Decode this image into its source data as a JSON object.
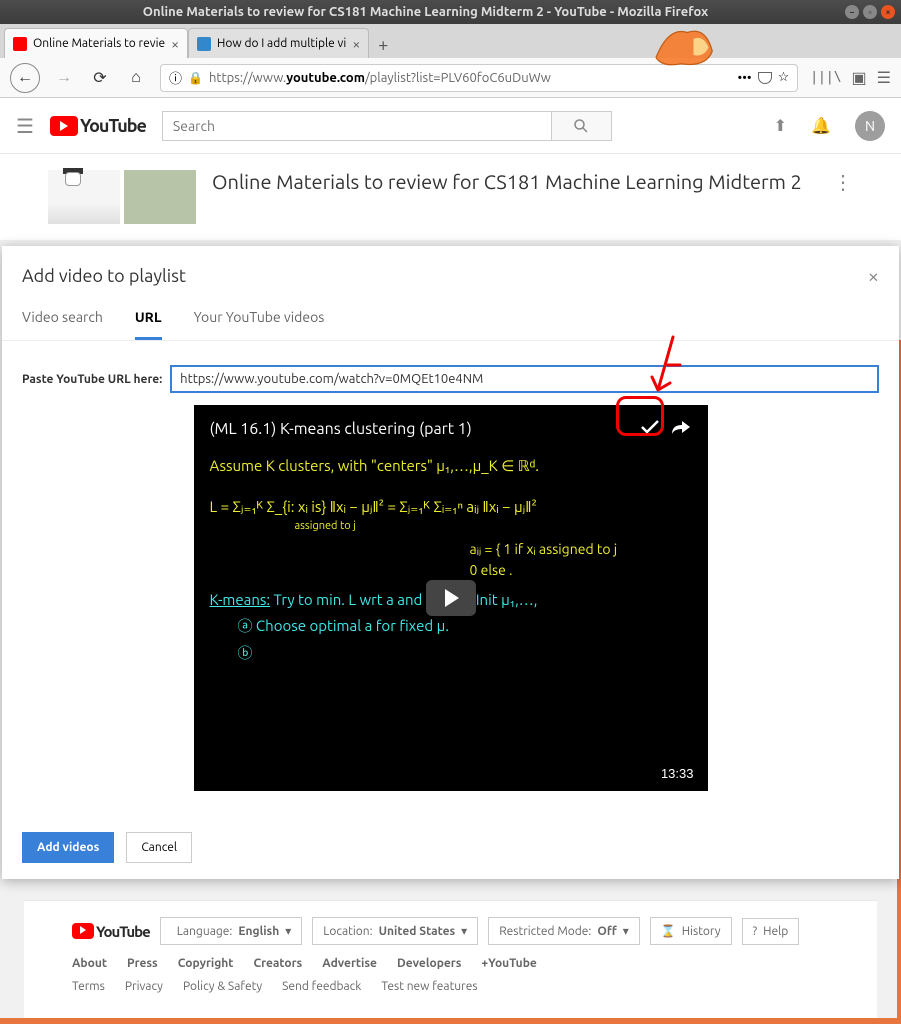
{
  "window": {
    "title": "Online Materials to review for CS181 Machine Learning Midterm 2 - YouTube - Mozilla Firefox"
  },
  "tabs": [
    {
      "label": "Online Materials to revie"
    },
    {
      "label": "How do I add multiple vi"
    }
  ],
  "url": {
    "prefix": "https://www.",
    "domain": "youtube.com",
    "path": "/playlist?list=PLV60foC6uDuWw"
  },
  "yt": {
    "brand": "YouTube",
    "search_placeholder": "Search",
    "avatar": "N"
  },
  "playlist": {
    "title": "Online Materials to review for CS181 Machine Learning Midterm 2"
  },
  "modal": {
    "title": "Add video to playlist",
    "tabs": {
      "search": "Video search",
      "url": "URL",
      "yours": "Your YouTube videos"
    },
    "url_label": "Paste YouTube URL here:",
    "url_value": "https://www.youtube.com/watch?v=0MQEt10e4NM",
    "video_title": "(ML 16.1) K-means clustering (part 1)",
    "duration": "13:33",
    "add": "Add videos",
    "cancel": "Cancel",
    "hw": {
      "l1": "Assume K clusters, with \"centers\" μ₁,…,μ_K ∈ ℝᵈ.",
      "l2": "L = Σⱼ₌₁ᴷ  Σ_{i: xᵢ is}  ‖xᵢ − μⱼ‖²  =  Σⱼ₌₁ᴷ Σᵢ₌₁ⁿ aᵢⱼ ‖xᵢ − μⱼ‖²",
      "l2b": "assigned to j",
      "l3": "aᵢⱼ = { 1  if xᵢ assigned to j",
      "l3b": "          0  else .",
      "l4a": "K-means:",
      "l4b": " Try to min. L  wrt  a  and  μ   by ⓪ Init μ₁,…,",
      "l5": "ⓐ Choose optimal a for fixed μ.",
      "l6": "ⓑ"
    }
  },
  "footer": {
    "lang_label": "Language:",
    "lang_val": "English",
    "loc_label": "Location:",
    "loc_val": "United States",
    "rm_label": "Restricted Mode:",
    "rm_val": "Off",
    "history": "History",
    "help": "Help",
    "links1": [
      "About",
      "Press",
      "Copyright",
      "Creators",
      "Advertise",
      "Developers",
      "+YouTube"
    ],
    "links2": [
      "Terms",
      "Privacy",
      "Policy & Safety",
      "Send feedback",
      "Test new features"
    ]
  }
}
